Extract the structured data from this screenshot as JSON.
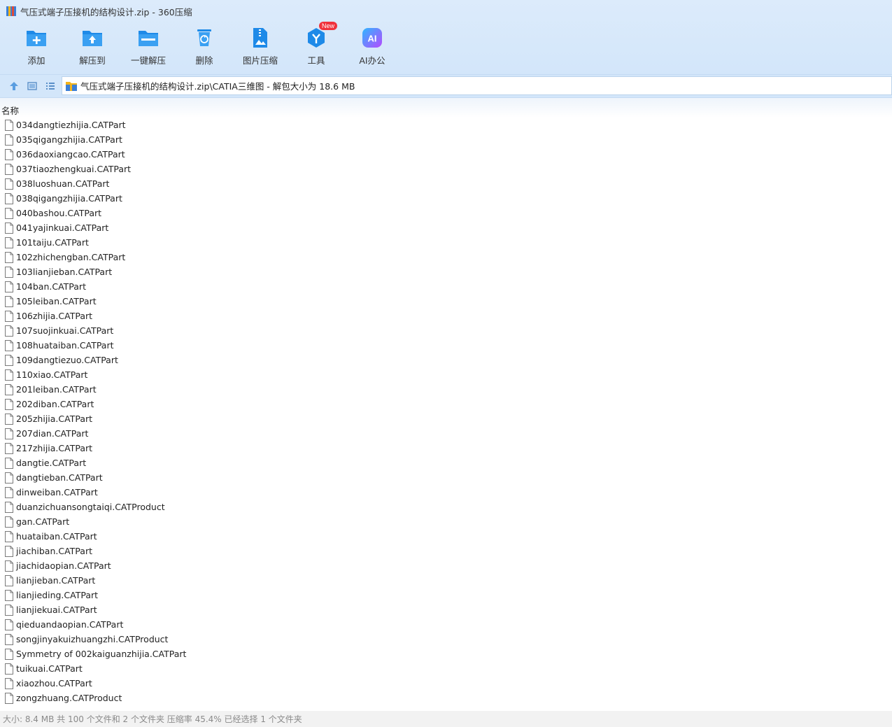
{
  "window": {
    "title": "气压式端子压接机的结构设计.zip - 360压缩"
  },
  "toolbar": {
    "items": [
      {
        "label": "添加",
        "icon": "add-icon"
      },
      {
        "label": "解压到",
        "icon": "extract-to-icon"
      },
      {
        "label": "一键解压",
        "icon": "one-click-extract-icon"
      },
      {
        "label": "删除",
        "icon": "delete-icon"
      },
      {
        "label": "图片压缩",
        "icon": "image-compress-icon"
      },
      {
        "label": "工具",
        "icon": "tools-icon",
        "badge": "New"
      },
      {
        "label": "AI办公",
        "icon": "ai-office-icon"
      }
    ]
  },
  "address": {
    "path": "气压式端子压接机的结构设计.zip\\CATIA三维图 - 解包大小为 18.6 MB"
  },
  "list": {
    "column_name": "名称",
    "files": [
      "034dangtiezhijia.CATPart",
      "035qigangzhijia.CATPart",
      "036daoxiangcao.CATPart",
      "037tiaozhengkuai.CATPart",
      "038luoshuan.CATPart",
      "038qigangzhijia.CATPart",
      "040bashou.CATPart",
      "041yajinkuai.CATPart",
      "101taiju.CATPart",
      "102zhichengban.CATPart",
      "103lianjieban.CATPart",
      "104ban.CATPart",
      "105leiban.CATPart",
      "106zhijia.CATPart",
      "107suojinkuai.CATPart",
      "108huataiban.CATPart",
      "109dangtiezuo.CATPart",
      "110xiao.CATPart",
      "201leiban.CATPart",
      "202diban.CATPart",
      "205zhijia.CATPart",
      "207dian.CATPart",
      "217zhijia.CATPart",
      "dangtie.CATPart",
      "dangtieban.CATPart",
      "dinweiban.CATPart",
      "duanzichuansongtaiqi.CATProduct",
      "gan.CATPart",
      "huataiban.CATPart",
      "jiachiban.CATPart",
      "jiachidaopian.CATPart",
      "lianjieban.CATPart",
      "lianjieding.CATPart",
      "lianjiekuai.CATPart",
      "qieduandaopian.CATPart",
      "songjinyakuizhuangzhi.CATProduct",
      "Symmetry of 002kaiguanzhijia.CATPart",
      "tuikuai.CATPart",
      "xiaozhou.CATPart",
      "zongzhuang.CATProduct"
    ]
  },
  "status": {
    "text": "大小: 8.4 MB 共 100 个文件和 2 个文件夹 压缩率 45.4% 已经选择 1 个文件夹"
  },
  "colors": {
    "accent": "#1e8ae8",
    "toolbar_bg": "#d3e6fa",
    "badge": "#f0323c"
  }
}
